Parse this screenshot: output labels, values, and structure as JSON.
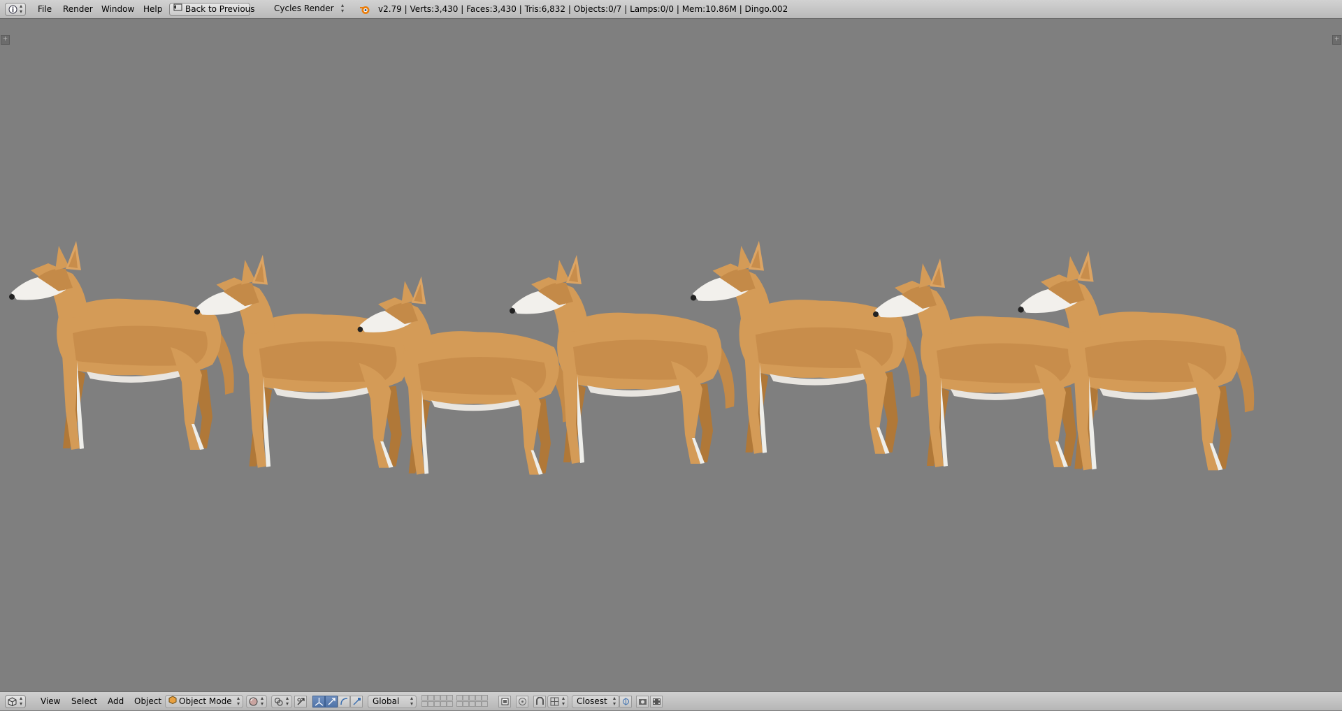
{
  "top_bar": {
    "editor_type_icon": "info-icon",
    "menus": [
      "File",
      "Render",
      "Window",
      "Help"
    ],
    "back_button": {
      "label": "Back to Previous",
      "icon": "back-screen-icon"
    },
    "render_engine": "Cycles Render",
    "blender_logo_icon": "blender-logo-icon",
    "stats": "v2.79 | Verts:3,430 | Faces:3,430 | Tris:6,832 | Objects:0/7 | Lamps:0/0 | Mem:10.86M | Dingo.002"
  },
  "viewport": {
    "background_color": "#7f7f7f",
    "object_color": "#d39a55",
    "object_count_shown": 7
  },
  "bottom_bar": {
    "editor_type_icon": "3d-view-cube-icon",
    "menus": [
      "View",
      "Select",
      "Add",
      "Object"
    ],
    "mode": {
      "label": "Object Mode",
      "icon": "object-cube-icon"
    },
    "shading_icon": "viewport-shading-sphere-icon",
    "pivot_icon": "pivot-point-icon",
    "manipulator_icons": [
      "translate-icon",
      "rotate-icon",
      "scale-icon"
    ],
    "orientation": "Global",
    "snap_target": "Closest",
    "right_icons": [
      "render-still-icon",
      "render-animation-icon"
    ]
  }
}
